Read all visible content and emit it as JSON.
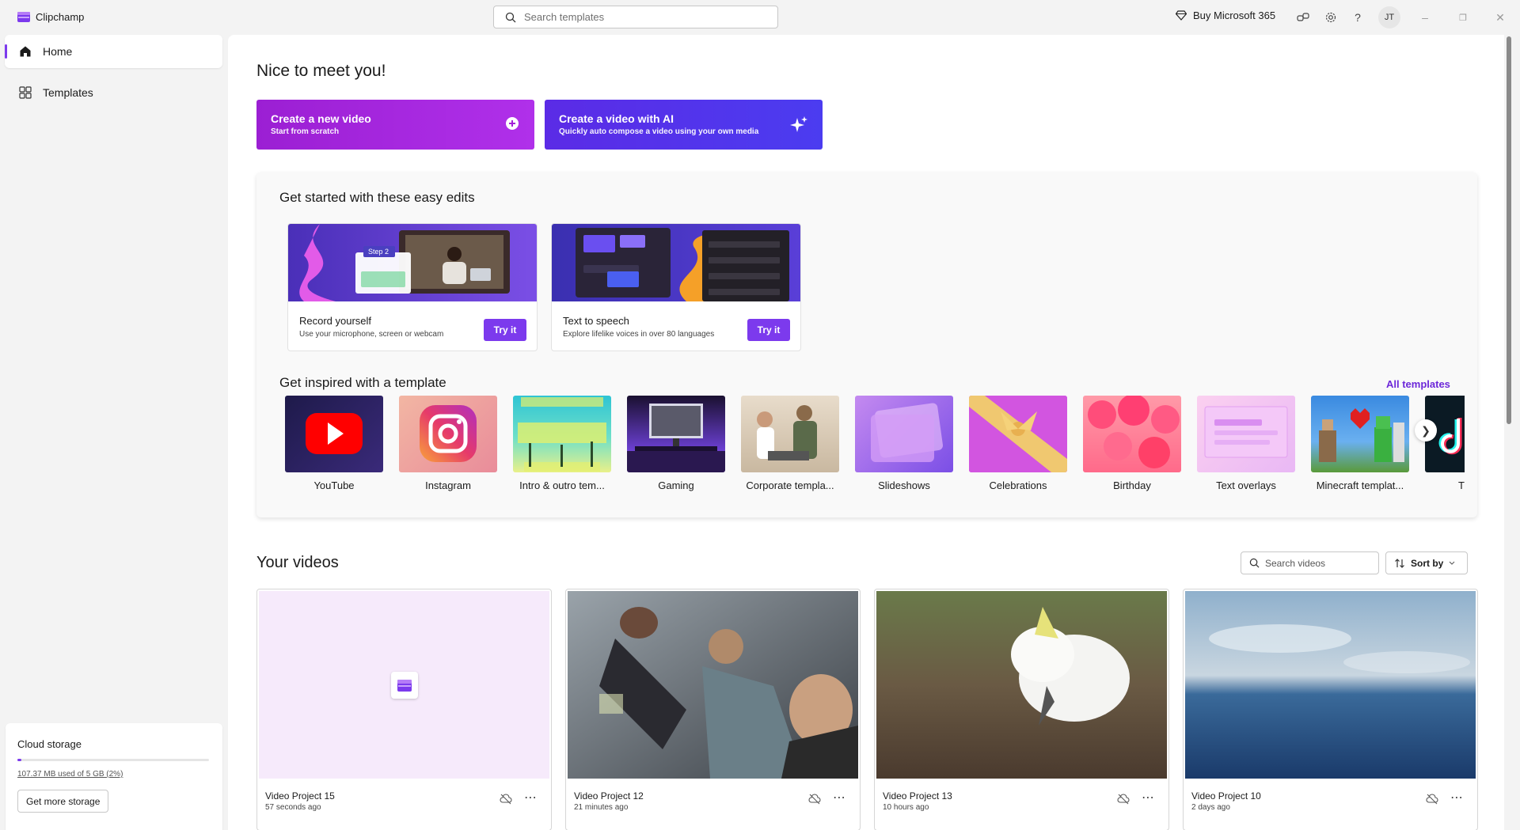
{
  "app": {
    "title": "Clipchamp"
  },
  "titlebar": {
    "search_placeholder": "Search templates",
    "buy_label": "Buy Microsoft 365",
    "avatar_initials": "JT"
  },
  "sidebar": {
    "items": [
      {
        "label": "Home",
        "icon": "home-icon",
        "active": true
      },
      {
        "label": "Templates",
        "icon": "templates-icon",
        "active": false
      }
    ],
    "storage": {
      "title": "Cloud storage",
      "usage_text": "107.37 MB used of 5 GB (2%)",
      "usage_percent": 2,
      "button_label": "Get more storage"
    }
  },
  "main": {
    "greeting": "Nice to meet you!",
    "cta": [
      {
        "title": "Create a new video",
        "subtitle": "Start from scratch",
        "icon": "plus-circle-icon"
      },
      {
        "title": "Create a video with AI",
        "subtitle": "Quickly auto compose a video using your own media",
        "icon": "sparkle-icon"
      }
    ],
    "easy_edits": {
      "title": "Get started with these easy edits",
      "cards": [
        {
          "title": "Record yourself",
          "subtitle": "Use your microphone, screen or webcam",
          "button": "Try it",
          "thumb_badge": "Step 2"
        },
        {
          "title": "Text to speech",
          "subtitle": "Explore lifelike voices in over 80 languages",
          "button": "Try it"
        }
      ]
    },
    "templates": {
      "title": "Get inspired with a template",
      "all_label": "All templates",
      "items": [
        {
          "label": "YouTube"
        },
        {
          "label": "Instagram"
        },
        {
          "label": "Intro & outro tem..."
        },
        {
          "label": "Gaming"
        },
        {
          "label": "Corporate templa..."
        },
        {
          "label": "Slideshows"
        },
        {
          "label": "Celebrations"
        },
        {
          "label": "Birthday"
        },
        {
          "label": "Text overlays"
        },
        {
          "label": "Minecraft templat..."
        },
        {
          "label": "TikTok"
        }
      ]
    },
    "videos": {
      "title": "Your videos",
      "search_placeholder": "Search videos",
      "sort_label": "Sort by",
      "items": [
        {
          "title": "Video Project 15",
          "time": "57 seconds ago"
        },
        {
          "title": "Video Project 12",
          "time": "21 minutes ago"
        },
        {
          "title": "Video Project 13",
          "time": "10 hours ago"
        },
        {
          "title": "Video Project 10",
          "time": "2 days ago"
        }
      ]
    }
  },
  "colors": {
    "accent": "#7c3aed",
    "cta_new": "#a21fd8",
    "cta_ai": "#5a2ee8"
  }
}
